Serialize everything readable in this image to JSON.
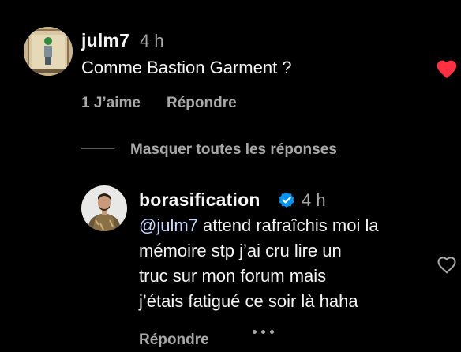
{
  "comment": {
    "username": "julm7",
    "time": "4 h",
    "text": "Comme Bastion Garment ?",
    "likes_label": "1 J’aime",
    "reply_label": "Répondre",
    "liked": true,
    "heart_color": "#ff3040",
    "avatar_icon": "avatar-photo"
  },
  "thread": {
    "hide_replies_label": "Masquer toutes les réponses"
  },
  "reply": {
    "username": "borasification",
    "verified": true,
    "verified_color": "#0095f6",
    "time": "4 h",
    "mention": "@julm7",
    "lines": [
      " attend rafraîchis moi la",
      "mémoire stp j’ai cru lire un",
      "truc sur mon forum mais",
      "j’étais fatigué ce soir là haha"
    ],
    "reply_label": "Répondre",
    "more_icon": "more-options-icon",
    "liked": false
  }
}
